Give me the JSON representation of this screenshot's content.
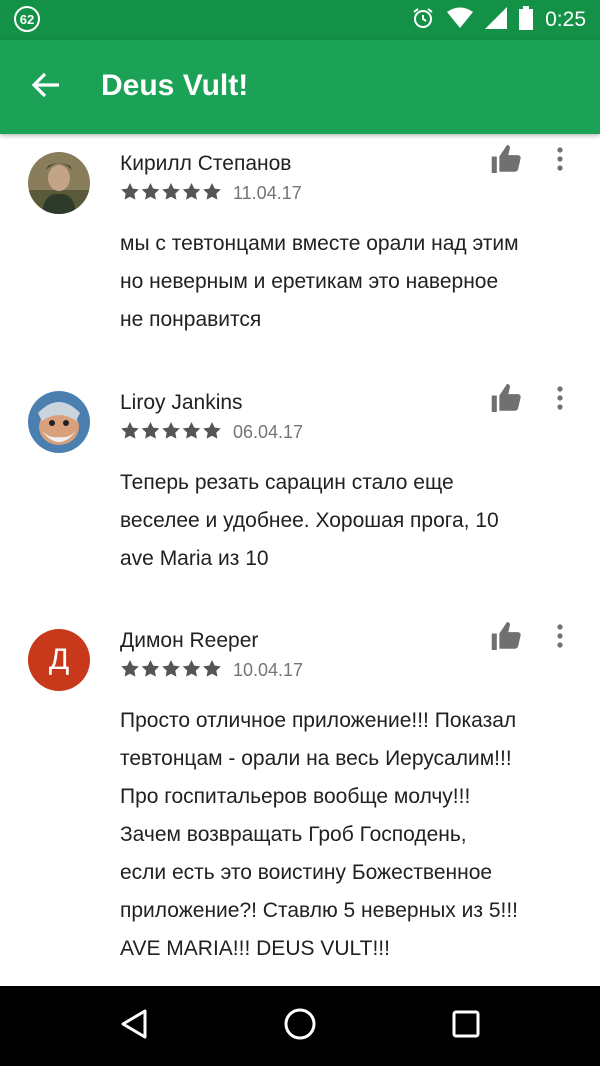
{
  "status_bar": {
    "notification_count": "62",
    "time": "0:25",
    "icons": [
      "alarm-icon",
      "wifi-icon",
      "signal-icon",
      "battery-icon"
    ]
  },
  "app_bar": {
    "title": "Deus Vult!",
    "back_icon": "arrow-left-icon",
    "color": "#1ba257"
  },
  "reviews": [
    {
      "name": "Кирилл Степанов",
      "rating": 5,
      "date": "11.04.17",
      "text": "мы с тевтонцами вместе орали над этим\nно неверным и еретикам это наверное\nне понравится"
    },
    {
      "name": "Liroy Jankins",
      "rating": 5,
      "date": "06.04.17",
      "text": "Теперь резать сарацин стало еще\nвеселее и удобнее. Хорошая прога, 10\nave Maria из 10"
    },
    {
      "name": "Димон Reeper",
      "avatar_letter": "Д",
      "avatar_color": "#c8381a",
      "rating": 5,
      "date": "10.04.17",
      "text": "Просто отличное приложение!!! Показал\nтевтонцам - орали на весь Иерусалим!!!\nПро госпитальеров вообще молчу!!!\nЗачем возвращать Гроб Господень,\nесли есть это воистину Божественное\nприложение?! Ставлю 5 неверных из 5!!!\nAVE MARIA!!! DEUS VULT!!!"
    }
  ],
  "nav_bar": {
    "icons": [
      "back-triangle-icon",
      "home-circle-icon",
      "recents-square-icon"
    ]
  }
}
